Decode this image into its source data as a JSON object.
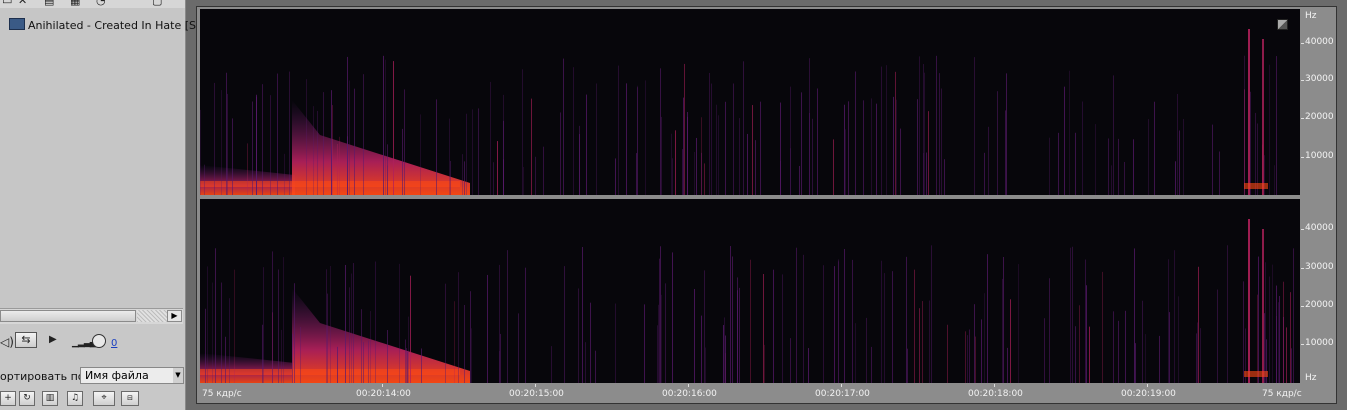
{
  "file_list": {
    "items": [
      {
        "label": "Anihilated - Created In Hate [Side"
      }
    ]
  },
  "playback": {
    "volume_value": "0"
  },
  "sort": {
    "label": "ортировать по:",
    "selected": "Имя файла"
  },
  "spectrogram": {
    "hz_axis_top": [
      "Hz",
      "40000",
      "30000",
      "20000",
      "10000"
    ],
    "hz_axis_bottom": [
      "40000",
      "30000",
      "20000",
      "10000",
      "Hz"
    ],
    "time_left_label": "75 кдр/с",
    "time_right_label": "75 кдр/с",
    "time_ticks": [
      "00:20:14:00",
      "00:20:15:00",
      "00:20:16:00",
      "00:20:17:00",
      "00:20:18:00",
      "00:20:19:00"
    ],
    "colors": {
      "background": "#07060b",
      "low": "#5a1a6e",
      "mid": "#b0205a",
      "high": "#ff4a14"
    }
  }
}
